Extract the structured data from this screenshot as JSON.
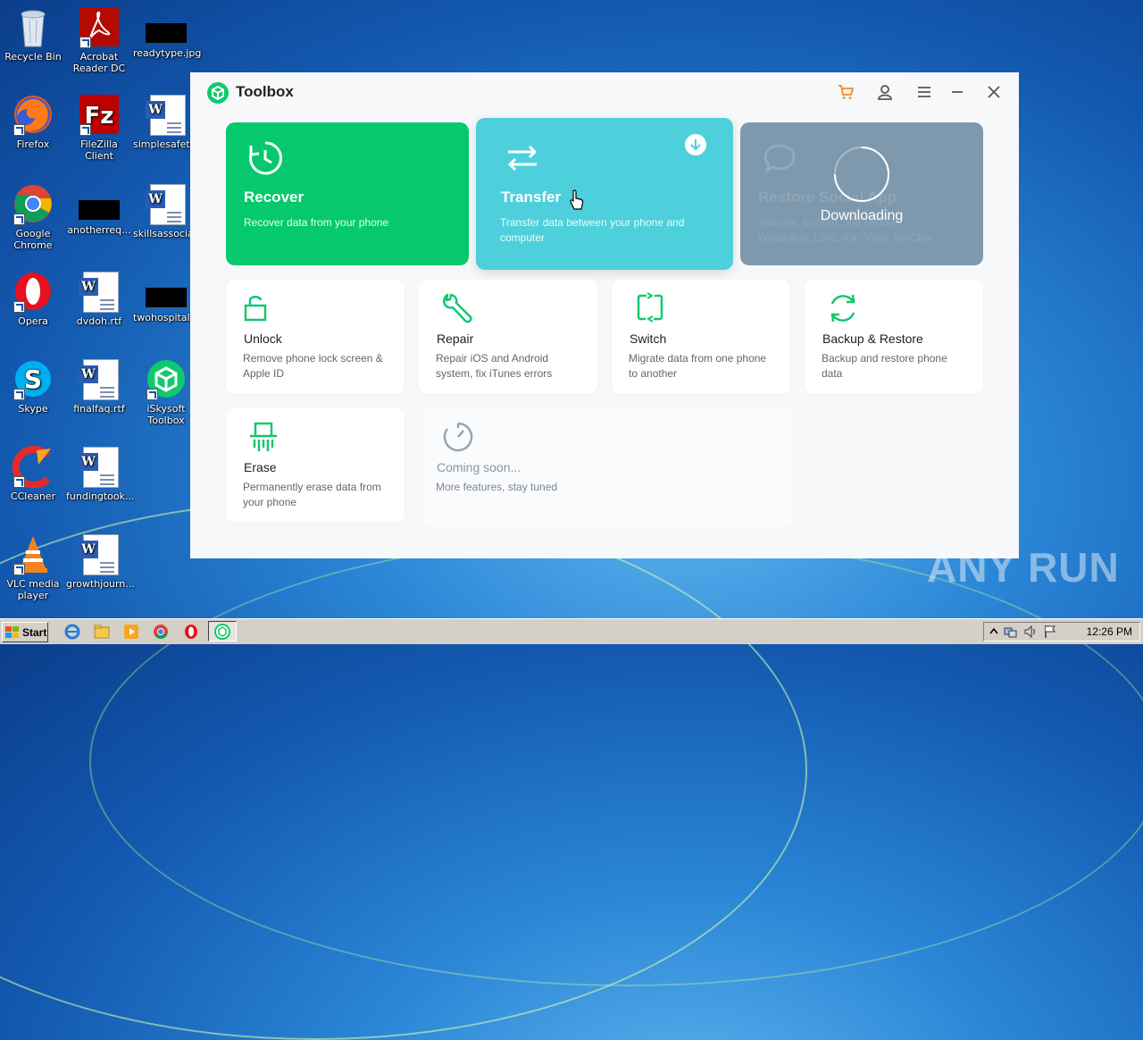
{
  "desktop": {
    "icons": [
      {
        "label": "Recycle Bin"
      },
      {
        "label": "Acrobat Reader DC"
      },
      {
        "label": "readytype.jpg"
      },
      {
        "label": "Firefox"
      },
      {
        "label": "FileZilla Client"
      },
      {
        "label": "simplesafet..."
      },
      {
        "label": "Google Chrome"
      },
      {
        "label": "anotherreq..."
      },
      {
        "label": "skillsassocia..."
      },
      {
        "label": "Opera"
      },
      {
        "label": "dvdoh.rtf"
      },
      {
        "label": "twohospital..."
      },
      {
        "label": "Skype"
      },
      {
        "label": "finalfaq.rtf"
      },
      {
        "label": "iSkysoft Toolbox"
      },
      {
        "label": "CCleaner"
      },
      {
        "label": "fundingtook..."
      },
      {
        "label": "VLC media player"
      },
      {
        "label": "growthjourn..."
      }
    ]
  },
  "app": {
    "title": "Toolbox",
    "accent": "#12c86f",
    "top_cards": [
      {
        "title": "Recover",
        "desc": "Recover data from your phone",
        "color": "#06c96d"
      },
      {
        "title": "Transfer",
        "desc": "Transfer data between your phone and computer",
        "color": "#4dd0dc"
      },
      {
        "title": "Restore Social App",
        "desc": "Transfer, backup, and restore WhatsApp, LINE, Kik, Viber, WeChat",
        "color": "#7e98ad",
        "overlay_text": "Downloading"
      }
    ],
    "tools": [
      {
        "title": "Unlock",
        "desc": "Remove phone lock screen & Apple ID"
      },
      {
        "title": "Repair",
        "desc": "Repair iOS and Android system, fix iTunes errors"
      },
      {
        "title": "Switch",
        "desc": "Migrate data from one phone to another"
      },
      {
        "title": "Backup & Restore",
        "desc": "Backup and restore phone data"
      },
      {
        "title": "Erase",
        "desc": "Permanently erase data from your phone"
      }
    ],
    "coming_soon": {
      "title": "Coming soon...",
      "desc": "More features, stay tuned"
    }
  },
  "taskbar": {
    "start_label": "Start",
    "clock": "12:26 PM"
  },
  "watermark": "ANY RUN"
}
